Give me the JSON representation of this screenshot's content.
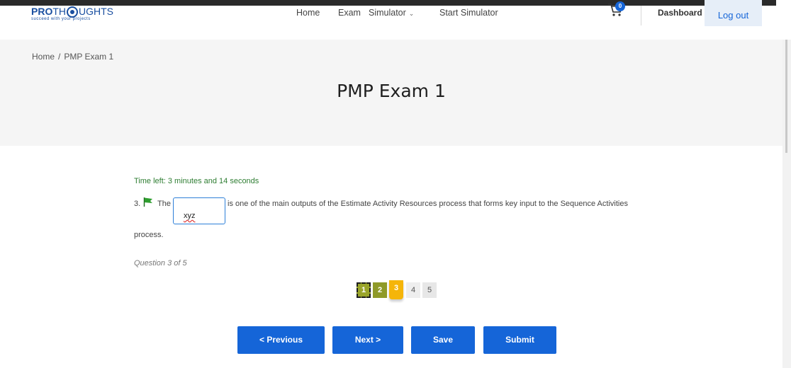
{
  "header": {
    "logo": {
      "brand_start": "PRO",
      "brand_end": "TH",
      "brand_tail": "UGHTS",
      "tagline": "succeed with your projects"
    },
    "nav": [
      {
        "label": "Home"
      },
      {
        "label": "Exam"
      },
      {
        "label": "Simulator"
      },
      {
        "label": "Start Simulator"
      }
    ],
    "cart_count": "0",
    "dashboard_label": "Dashboard",
    "logout_label": "Log out"
  },
  "breadcrumb": {
    "home": "Home",
    "separator": "/",
    "current": "PMP Exam 1"
  },
  "page_title": "PMP Exam 1",
  "quiz": {
    "timer": "Time left: 3 minutes and 14 seconds",
    "question_number": "3.",
    "question_start": "The",
    "answer_value": "xyz",
    "question_rest": "is one of the main outputs of the Estimate Activity Resources process that forms key input to the Sequence Activities",
    "question_cont": "process.",
    "question_count": "Question 3 of 5",
    "pages": [
      "1",
      "2",
      "3",
      "4",
      "5"
    ],
    "buttons": {
      "previous": "< Previous",
      "next": "Next >",
      "save": "Save",
      "submit": "Submit"
    }
  },
  "colors": {
    "accent": "#1565d8",
    "timer": "#2e7d32",
    "page_answered": "#9aa52a",
    "page_current": "#f5b50a",
    "flag": "#2e9e2e"
  },
  "icons": {
    "cart": "cart-icon",
    "flag": "flag-icon",
    "chevron": "chevron-down-icon"
  }
}
